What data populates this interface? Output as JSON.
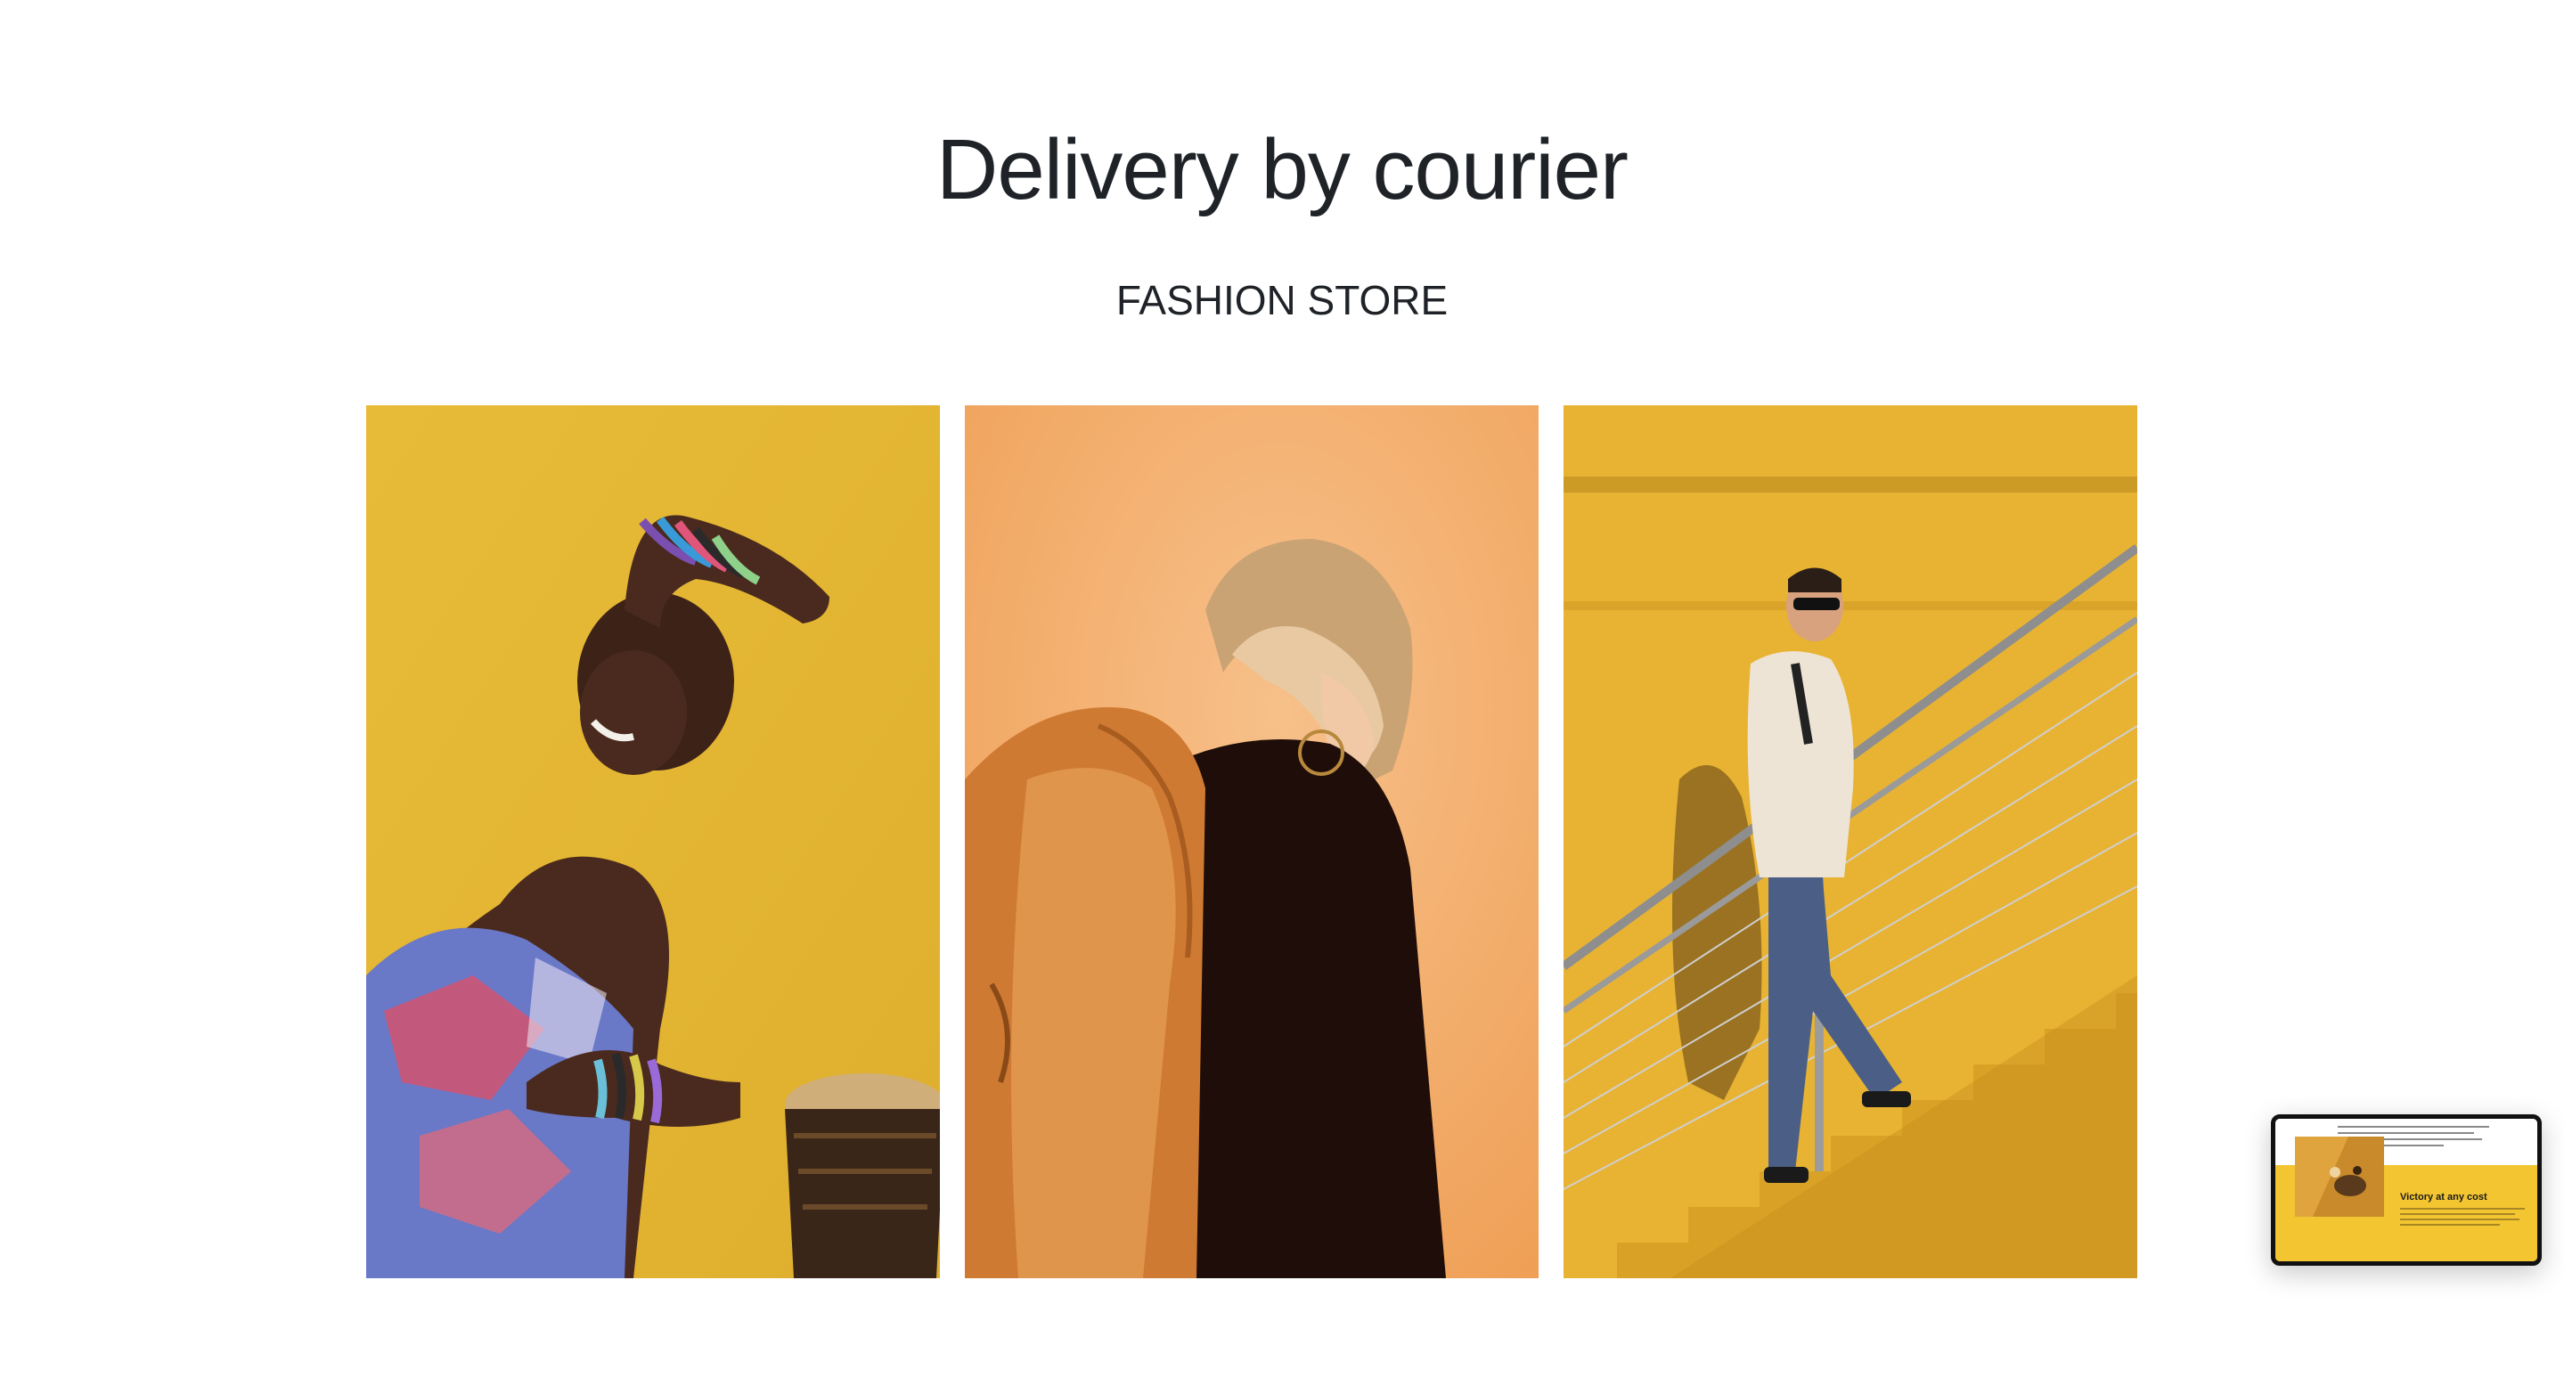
{
  "header": {
    "title": "Delivery by courier",
    "subtitle": "FASHION STORE"
  },
  "gallery": {
    "photos": [
      {
        "icon": "photo-woman-bangles-drum",
        "background": "#e5b833"
      },
      {
        "icon": "photo-woman-orange-jacket",
        "background": "#f2a55e"
      },
      {
        "icon": "photo-man-yellow-staircase",
        "background": "#e8b333"
      }
    ]
  },
  "preview": {
    "heading": "Victory at any cost",
    "accent": "#f3c531"
  }
}
